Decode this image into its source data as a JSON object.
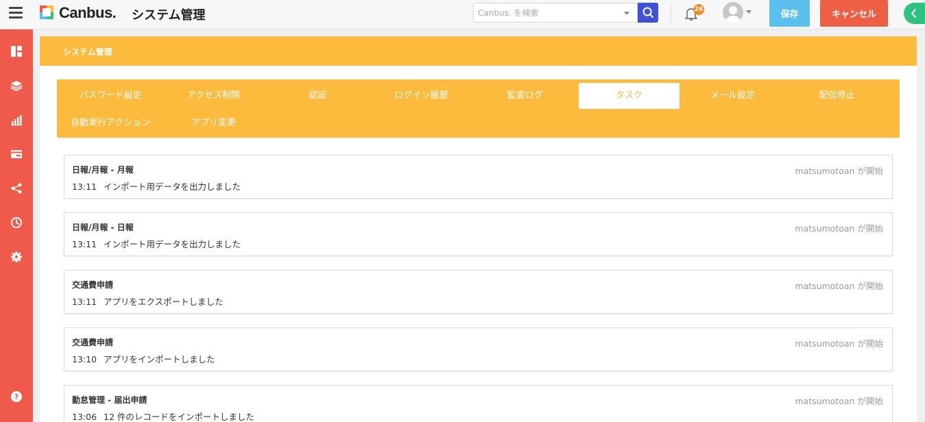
{
  "header": {
    "brand": "Canbus.",
    "title": "システム管理",
    "search_placeholder": "Canbus. を検索",
    "notification_count": "26",
    "save_label": "保存",
    "cancel_label": "キャンセル"
  },
  "sidebar": {
    "icons": [
      "dashboard-icon",
      "layers-icon",
      "chart-icon",
      "card-icon",
      "share-icon",
      "history-icon",
      "gear-icon",
      "help-icon"
    ]
  },
  "main": {
    "section_title": "システム管理",
    "tabs": [
      {
        "label": "パスワード設定"
      },
      {
        "label": "アクセス制限"
      },
      {
        "label": "認証"
      },
      {
        "label": "ログイン履歴"
      },
      {
        "label": "監査ログ"
      },
      {
        "label": "タスク",
        "active": true
      },
      {
        "label": "メール設定"
      },
      {
        "label": "配信停止"
      },
      {
        "label": "自動実行アクション"
      },
      {
        "label": "アプリ変更"
      }
    ],
    "tasks": [
      {
        "name": "日報/月報 - 月報",
        "time": "13:11",
        "message": "インポート用データを出力しました",
        "user": "matsumotoan が開始"
      },
      {
        "name": "日報/月報 - 日報",
        "time": "13:11",
        "message": "インポート用データを出力しました",
        "user": "matsumotoan が開始"
      },
      {
        "name": "交通費申請",
        "time": "13:11",
        "message": "アプリをエクスポートしました",
        "user": "matsumotoan が開始"
      },
      {
        "name": "交通費申請",
        "time": "13:10",
        "message": "アプリをインポートしました",
        "user": "matsumotoan が開始"
      },
      {
        "name": "勤怠管理 - 届出申請",
        "time": "13:06",
        "message": "12 件のレコードをインポートしました",
        "user": "matsumotoan が開始"
      }
    ]
  },
  "colors": {
    "accent": "#fdbb3d",
    "sidebar": "#ef5a4b",
    "save": "#5bc0ee",
    "cancel": "#ee6046",
    "search_button": "#3f51d4"
  }
}
